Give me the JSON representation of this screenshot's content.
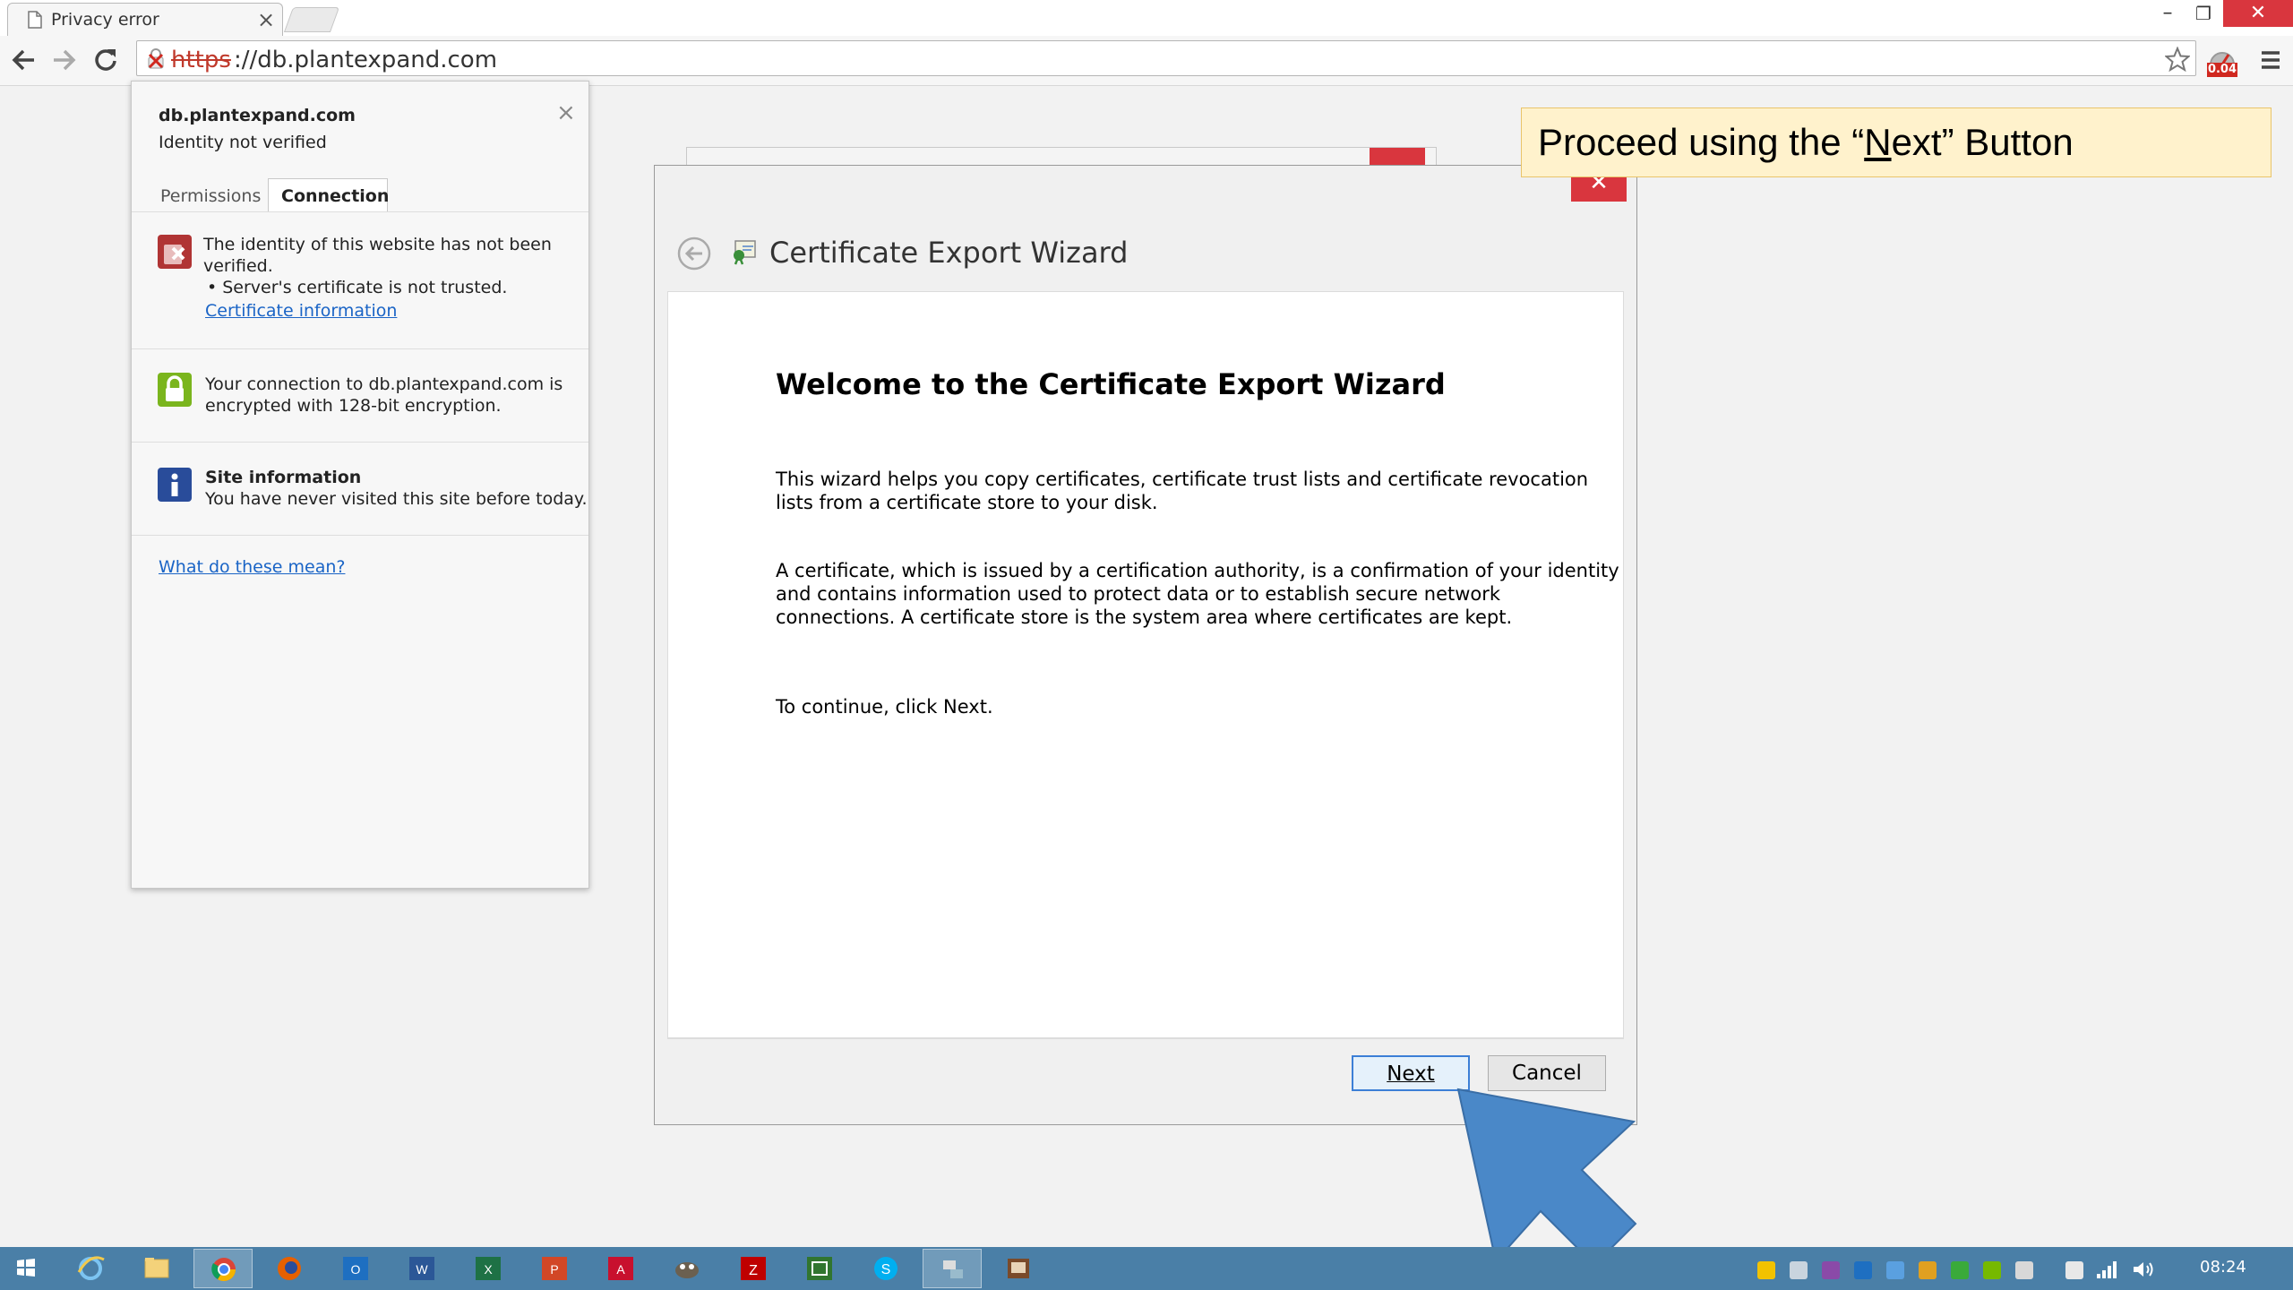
{
  "browser": {
    "tab_title": "Privacy error",
    "tab_close": "×",
    "url_scheme": "https",
    "url_rest": "://db.plantexpand.com",
    "ext_badge": "0.04",
    "window_controls": {
      "minimize": "–",
      "maximize": "❐",
      "close": "✕"
    }
  },
  "popup": {
    "site": "db.plantexpand.com",
    "identity": "Identity not verified",
    "close": "×",
    "tabs": [
      "Permissions",
      "Connection"
    ],
    "active_tab": "Connection",
    "identity_block": {
      "line1": "The identity of this website has not been",
      "line2": "verified.",
      "bullet": "• Server's certificate is not trusted.",
      "link": "Certificate information"
    },
    "encryption_block": {
      "line1": "Your connection to db.plantexpand.com is",
      "line2": "encrypted with 128-bit encryption."
    },
    "site_info": {
      "title": "Site information",
      "text": "You have never visited this site before today."
    },
    "help_link": "What do these mean?"
  },
  "dialog": {
    "title": "Certificate Export Wizard",
    "heading": "Welcome to the Certificate Export Wizard",
    "p1_line1": "This wizard helps you copy certificates, certificate trust lists and certificate revocation",
    "p1_line2": "lists from a certificate store to your disk.",
    "p2_line1": "A certificate, which is issued by a certification authority, is a confirmation of your identity",
    "p2_line2": "and contains information used to protect data or to establish secure network",
    "p2_line3": "connections. A certificate store is the system area where certificates are kept.",
    "p3": "To continue, click Next.",
    "next_button": "Next",
    "cancel_button": "Cancel",
    "close_glyph": "✕"
  },
  "callout": {
    "before": "Proceed using the “",
    "mnemonic": "N",
    "after": "ext” Button"
  },
  "taskbar": {
    "clock": "08:24",
    "apps": [
      "windows-start",
      "internet-explorer",
      "file-explorer",
      "chrome",
      "firefox",
      "outlook",
      "word",
      "excel",
      "powerpoint",
      "acrobat",
      "gimp",
      "filezilla",
      "project",
      "skype",
      "network-tool",
      "presentation"
    ],
    "active_app": "chrome"
  },
  "colors": {
    "taskbar": "#4a7fa7",
    "dialog_close": "#d9363e",
    "callout_bg": "#fff2cc",
    "link": "#1a64c6",
    "arrow": "#4a88c8"
  }
}
